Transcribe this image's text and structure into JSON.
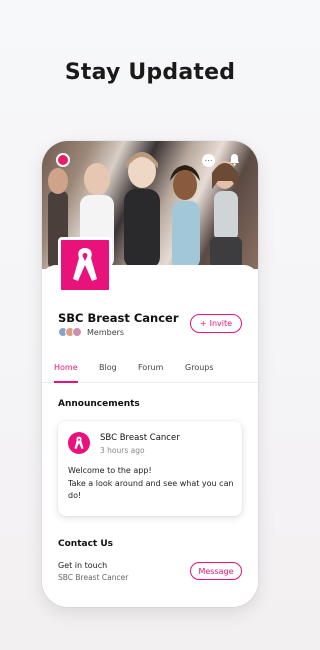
{
  "headline": "Stay Updated",
  "group": {
    "name": "SBC Breast Cancer",
    "members_label": "Members",
    "invite_label": "Invite",
    "invite_prefix": "+"
  },
  "tabs": [
    {
      "label": "Home",
      "active": true
    },
    {
      "label": "Blog",
      "active": false
    },
    {
      "label": "Forum",
      "active": false
    },
    {
      "label": "Groups",
      "active": false
    }
  ],
  "announcements": {
    "title": "Announcements",
    "post": {
      "author": "SBC Breast Cancer",
      "time": "3 hours ago",
      "line1": "Welcome to the app!",
      "line2": "Take a look around and see what you can do!"
    }
  },
  "contact": {
    "title": "Contact Us",
    "label": "Get in touch",
    "sub": "SBC Breast Cancer",
    "message_label": "Message"
  },
  "colors": {
    "accent": "#e8127a",
    "background": "#f5f5f7"
  },
  "icons": {
    "ribbon": "pink-ribbon-icon",
    "chat": "chat-icon",
    "bell": "bell-icon"
  }
}
